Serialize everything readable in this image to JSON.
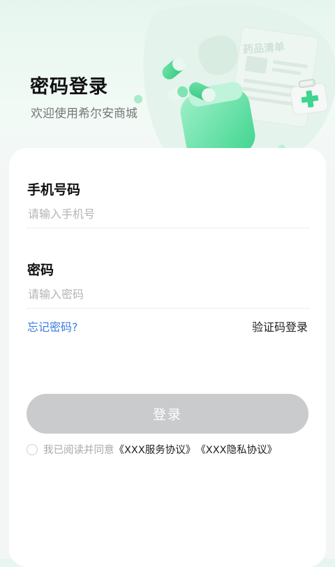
{
  "hero": {
    "title": "密码登录",
    "subtitle": "欢迎使用希尔安商城",
    "illustration_text": "药品清单"
  },
  "form": {
    "phone": {
      "label": "手机号码",
      "placeholder": "请输入手机号",
      "value": ""
    },
    "password": {
      "label": "密码",
      "placeholder": "请输入密码",
      "value": ""
    },
    "forgot_password": "忘记密码?",
    "sms_login": "验证码登录",
    "login_button": "登录"
  },
  "agreement": {
    "checked": false,
    "prefix": "我已阅读并同意",
    "service": "《XXX服务协议》",
    "privacy": "《XXX隐私协议》"
  },
  "colors": {
    "accent_link": "#3a7be0",
    "button_disabled": "#c9cbcc",
    "brand_green": "#3fd58f"
  }
}
